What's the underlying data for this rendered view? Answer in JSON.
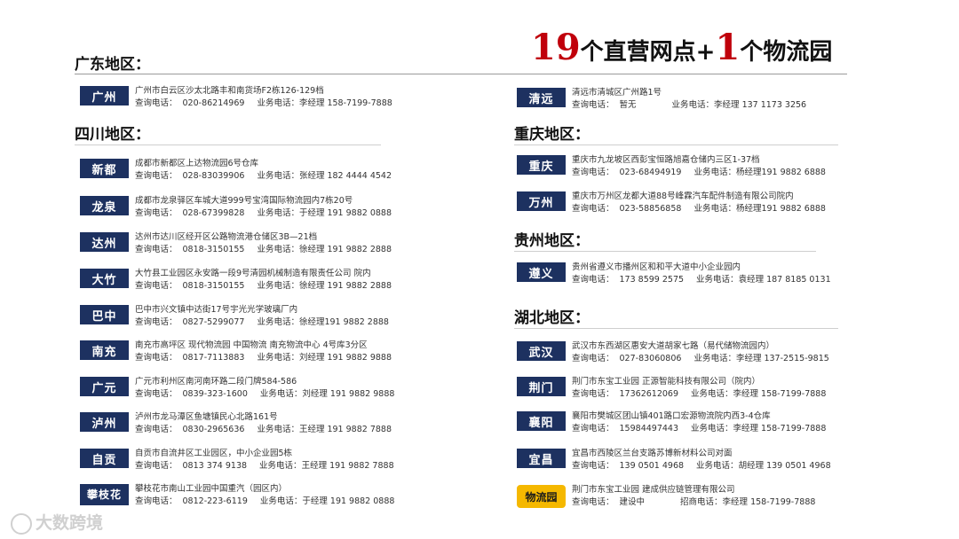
{
  "headline": {
    "n1": "19",
    "t1": "个直营网点+",
    "n2": "1",
    "t2": "个物流园"
  },
  "labels": {
    "query": "查询电话：",
    "business": "业务电话：",
    "merchant": "招商电话："
  },
  "regions": {
    "guangdong": "广东地区：",
    "sichuan": "四川地区：",
    "chongqing": "重庆地区：",
    "guizhou": "贵州地区：",
    "hubei": "湖北地区："
  },
  "guangdong": [
    {
      "city": "广州",
      "address": "广州市白云区沙太北路丰和南货场F2栋126-129档",
      "query": "020-86214969",
      "business": "李经理 158-7199-7888"
    }
  ],
  "sichuan": [
    {
      "city": "新都",
      "address": "成都市新都区上达物流园6号仓库",
      "query": "028-83039906",
      "business": "张经理 182 4444 4542"
    },
    {
      "city": "龙泉",
      "address": "成都市龙泉驿区车城大道999号宝湾国际物流园内7栋20号",
      "query": "028-67399828",
      "business": "于经理 191 9882 0888"
    },
    {
      "city": "达州",
      "address": "达州市达川区经开区公路物流港仓储区3B—21档",
      "query": "0818-3150155",
      "business": "徐经理 191 9882 2888"
    },
    {
      "city": "大竹",
      "address": "大竹县工业园区永安路一段9号清园机械制造有限责任公司 院内",
      "query": "0818-3150155",
      "business": "徐经理 191 9882 2888"
    },
    {
      "city": "巴中",
      "address": "巴中市兴文镇中达街17号宇光光学玻璃厂内",
      "query": "0827-5299077",
      "business": "徐经理191 9882 2888"
    },
    {
      "city": "南充",
      "address": "南充市高坪区 现代物流园 中国物流 南充物流中心 4号库3分区",
      "query": "0817-7113883",
      "business": "刘经理 191 9882 9888"
    },
    {
      "city": "广元",
      "address": "广元市利州区南河南环路二段门牌584-586",
      "query": "0839-323-1600",
      "business": "刘经理 191 9882 9888"
    },
    {
      "city": "泸州",
      "address": "泸州市龙马潭区鱼塘镇民心北路161号",
      "query": "0830-2965636",
      "business": "王经理 191 9882 7888"
    },
    {
      "city": "自贡",
      "address": "自贡市自流井区工业园区，中小企业园5栋",
      "query": "0813 374 9138",
      "business": "王经理 191 9882 7888"
    },
    {
      "city": "攀枝花",
      "address": "攀枝花市南山工业园中国重汽（园区内）",
      "query": "0812-223-6119",
      "business": "于经理 191 9882 0888"
    }
  ],
  "qingyuan": {
    "city": "清远",
    "address": "清远市清城区广州路1号",
    "query": "暂无",
    "business": "李经理 137 1173 3256"
  },
  "chongqing": [
    {
      "city": "重庆",
      "address": "重庆市九龙坡区西彭宝恒路旭嘉仓储内三区1-37档",
      "query": "023-68494919",
      "business": "杨经理191 9882 6888"
    },
    {
      "city": "万州",
      "address": "重庆市万州区龙都大道88号峰霖汽车配件制造有限公司院内",
      "query": "023-58856858",
      "business": "杨经理191 9882 6888"
    }
  ],
  "guizhou": [
    {
      "city": "遵义",
      "address": "贵州省遵义市播州区和和平大道中小企业园内",
      "query": "173 8599 2575",
      "business": "袁经理 187 8185 0131"
    }
  ],
  "hubei": [
    {
      "city": "武汉",
      "address": "武汉市东西湖区惠安大道胡家七路（易代储物流园内）",
      "query": "027-83060806",
      "business": "李经理 137-2515-9815"
    },
    {
      "city": "荆门",
      "address": "荆门市东宝工业园 正源智能科技有限公司（院内）",
      "query": "17362612069",
      "business": "李经理 158-7199-7888"
    },
    {
      "city": "襄阳",
      "address": "襄阳市樊城区团山镇401路口宏源物流院内西3-4仓库",
      "query": "15984497443",
      "business": "李经理 158-7199-7888"
    },
    {
      "city": "宜昌",
      "address": "宜昌市西陵区兰台支路苏博新材料公司对面",
      "query": "139 0501 4968",
      "business": "胡经理 139 0501 4968"
    }
  ],
  "park": {
    "city": "物流园",
    "address": "荆门市东宝工业园 建成供应链管理有限公司",
    "query": "建设中",
    "business": "李经理 158-7199-7888"
  },
  "watermark": "大数跨境"
}
